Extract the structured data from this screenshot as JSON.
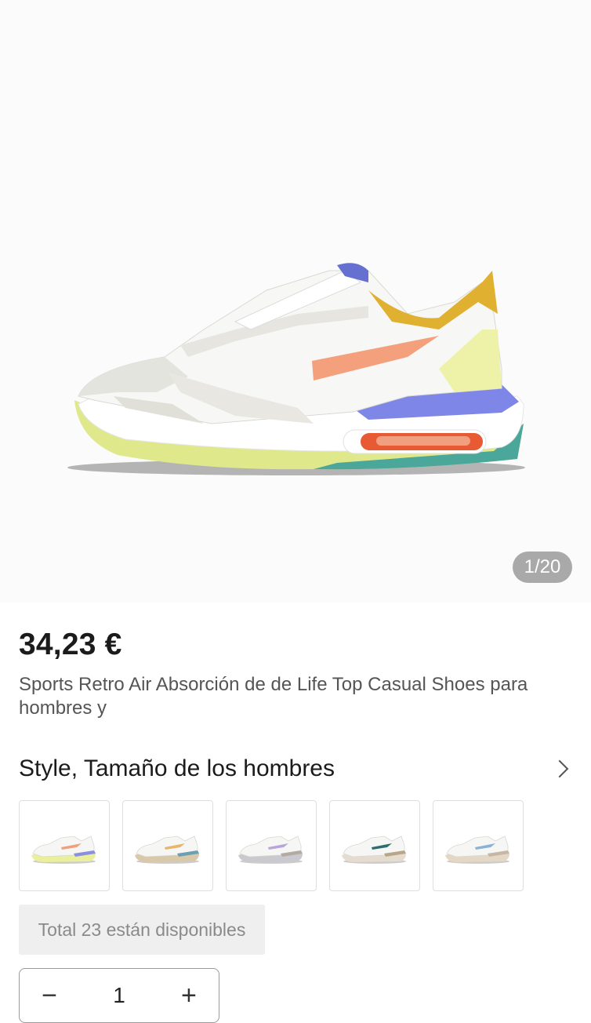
{
  "gallery": {
    "counter": "1/20",
    "image_alt": "white sneaker with orange, lilac and yellow accents"
  },
  "product": {
    "price": "34,23 €",
    "title": "Sports Retro Air Absorción de de Life Top Casual Shoes para hombres y"
  },
  "variants": {
    "header": "Style, Tamaño de los hombres",
    "items": [
      {
        "accent": "#f0a07a",
        "side": "#8a8fe0",
        "sole": "#e9ef9a"
      },
      {
        "accent": "#e8b56a",
        "side": "#6c9fb3",
        "sole": "#d9c9a8"
      },
      {
        "accent": "#b9a6d8",
        "side": "#b3aaa4",
        "sole": "#c9c9cf"
      },
      {
        "accent": "#2e6d72",
        "side": "#b9a48c",
        "sole": "#e5dccf"
      },
      {
        "accent": "#8ab1d6",
        "side": "#c5b6a5",
        "sole": "#e4d8c4"
      }
    ]
  },
  "stock": {
    "text": "Total 23 están disponibles"
  },
  "quantity": {
    "minus": "−",
    "value": "1",
    "plus": "+"
  },
  "colors": {
    "counter_bg": "#a9a9a9",
    "avail_bg": "#efefef"
  }
}
